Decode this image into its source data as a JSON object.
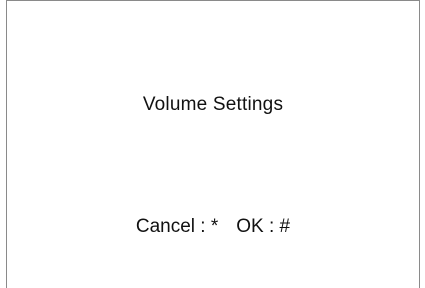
{
  "screen": {
    "title": "Volume Settings",
    "softkeys": {
      "cancel": "Cancel : *",
      "ok": "OK : #"
    }
  }
}
